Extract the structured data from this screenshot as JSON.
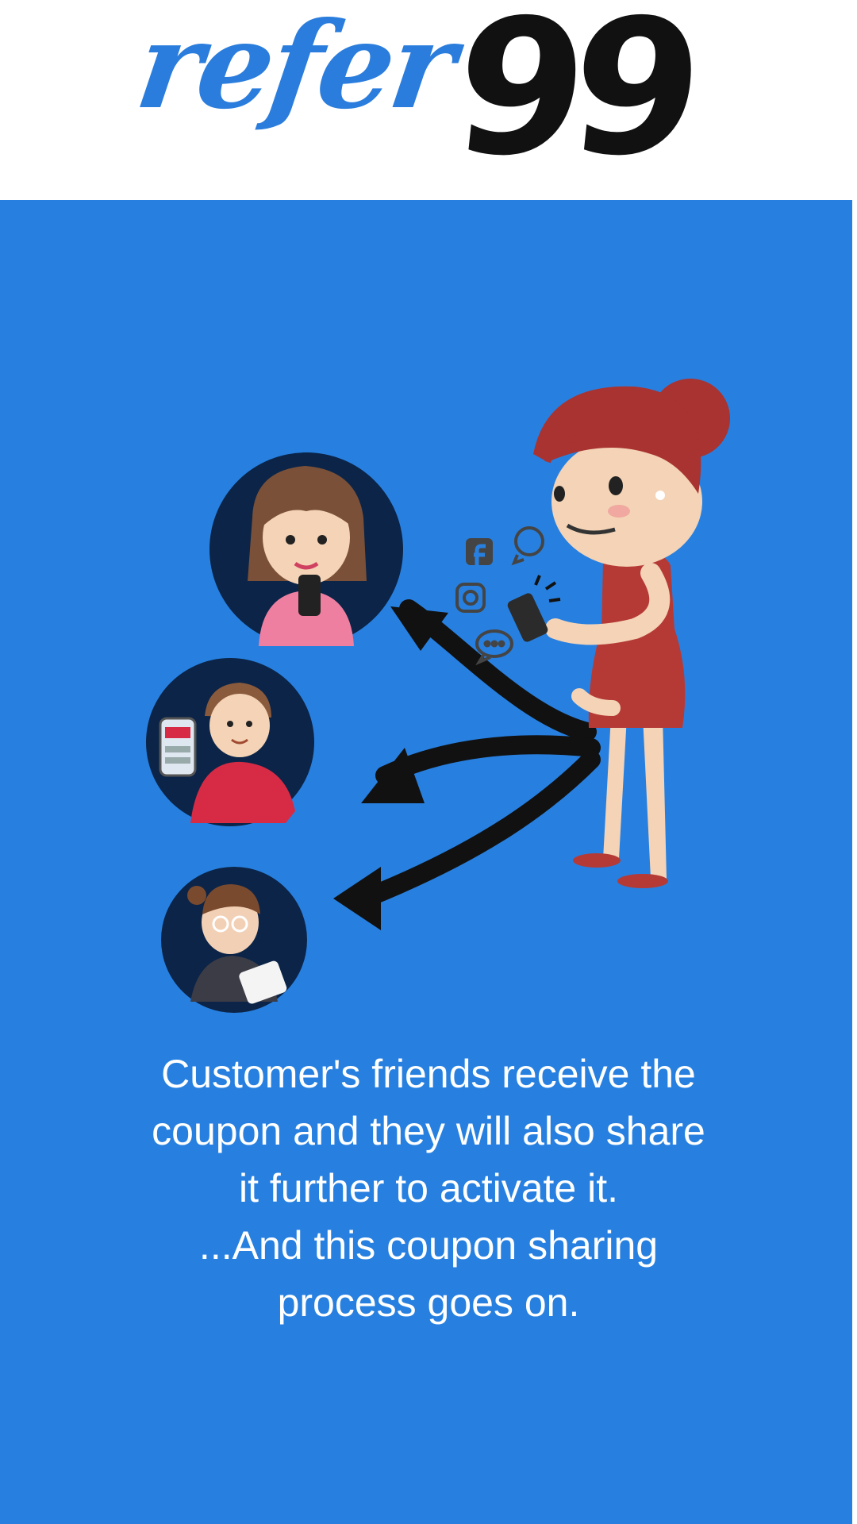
{
  "logo": {
    "word": "refer",
    "number": "99"
  },
  "caption": {
    "lines": [
      "Customer's friends receive the",
      "coupon and they will also share",
      "it further to activate it.",
      "...And this coupon sharing",
      "process goes on."
    ]
  },
  "colors": {
    "brand_blue": "#2780e0",
    "logo_blue": "#2a7ddc",
    "logo_black": "#111111",
    "avatar_circle": "#0b2447",
    "dress_red": "#b53a36"
  },
  "illustration": {
    "icons": [
      "facebook-icon",
      "whatsapp-icon",
      "instagram-icon",
      "chat-bubble-icon"
    ]
  }
}
